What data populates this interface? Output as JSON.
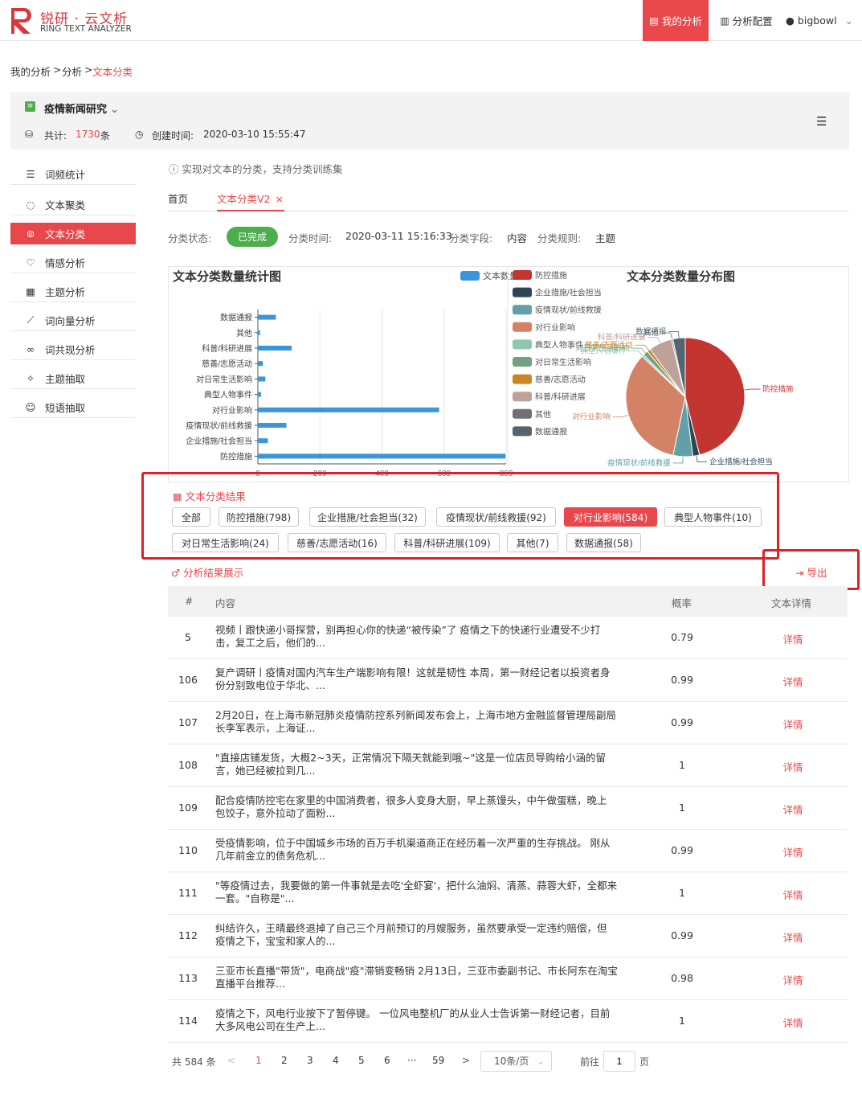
{
  "brand": {
    "title": "锐研 · 云文析",
    "subtitle": "RING TEXT ANALYZER"
  },
  "nav": {
    "my_analysis": "我的分析",
    "config": "分析配置",
    "user": "bigbowl"
  },
  "breadcrumb": {
    "a": "我的分析",
    "sep": ">",
    "b": "分析",
    "c": "文本分类"
  },
  "project": {
    "name": "疫情新闻研究",
    "total_label": "共计:",
    "total": "1730",
    "total_unit": "条",
    "created_label": "创建时间:",
    "created": "2020-03-10 15:55:47"
  },
  "sidebar": [
    {
      "label": "词频统计",
      "icon": "list-icon"
    },
    {
      "label": "文本聚类",
      "icon": "cluster-icon"
    },
    {
      "label": "文本分类",
      "icon": "classify-icon"
    },
    {
      "label": "情感分析",
      "icon": "heartbeat-icon"
    },
    {
      "label": "主题分析",
      "icon": "grid-icon"
    },
    {
      "label": "词向量分析",
      "icon": "vector-icon"
    },
    {
      "label": "词共现分析",
      "icon": "link-icon"
    },
    {
      "label": "主题抽取",
      "icon": "star-icon"
    },
    {
      "label": "短语抽取",
      "icon": "chat-icon"
    }
  ],
  "hint": "实现对文本的分类，支持分类训练集",
  "tabs": {
    "home": "首页",
    "current": "文本分类V2",
    "close": "×"
  },
  "status": {
    "state_label": "分类状态:",
    "state": "已完成",
    "time_label": "分类时间:",
    "time": "2020-03-11 15:16:33",
    "field_label": "分类字段:",
    "field": "内容",
    "rule_label": "分类规则:",
    "rule": "主题"
  },
  "colors": {
    "accent": "#e8484c",
    "bar": "#3a96d8",
    "done": "#4cae4c"
  },
  "chart_data": [
    {
      "type": "bar",
      "title": "文本分类数量统计图",
      "legend": "文本数量",
      "orientation": "horizontal",
      "categories": [
        "数据通报",
        "其他",
        "科普/科研进展",
        "慈善/志愿活动",
        "对日常生活影响",
        "典型人物事件",
        "对行业影响",
        "疫情现状/前线救援",
        "企业措施/社会担当",
        "防控措施"
      ],
      "values": [
        58,
        7,
        109,
        16,
        24,
        10,
        584,
        92,
        32,
        798
      ],
      "xticks": [
        "0",
        "200",
        "400",
        "600",
        "800"
      ],
      "xlim": [
        0,
        800
      ]
    },
    {
      "type": "pie",
      "title": "文本分类数量分布图",
      "labels": [
        "防控措施",
        "企业措施/社会担当",
        "疫情现状/前线救援",
        "对行业影响",
        "典型人物事件",
        "对日常生活影响",
        "慈善/志愿活动",
        "科普/科研进展",
        "其他",
        "数据通报"
      ],
      "values": [
        798,
        32,
        92,
        584,
        10,
        24,
        16,
        109,
        7,
        58
      ],
      "colors": [
        "#c23531",
        "#2f4554",
        "#61a0a8",
        "#d48265",
        "#91c7ae",
        "#749f83",
        "#ca8622",
        "#bda29a",
        "#6e7074",
        "#546570"
      ]
    }
  ],
  "result": {
    "title": "文本分类结果",
    "tags": [
      {
        "label": "全部"
      },
      {
        "label": "防控措施(798)"
      },
      {
        "label": "企业措施/社会担当(32)"
      },
      {
        "label": "疫情现状/前线救援(92)"
      },
      {
        "label": "对行业影响(584)",
        "selected": true
      },
      {
        "label": "典型人物事件(10)"
      },
      {
        "label": "对日常生活影响(24)"
      },
      {
        "label": "慈善/志愿活动(16)"
      },
      {
        "label": "科普/科研进展(109)"
      },
      {
        "label": "其他(7)"
      },
      {
        "label": "数据通报(58)"
      }
    ]
  },
  "analysis": {
    "title": "分析结果展示",
    "export": "导出"
  },
  "table": {
    "headers": {
      "no": "#",
      "content": "内容",
      "prob": "概率",
      "detail": "文本详情"
    },
    "rows": [
      {
        "no": "5",
        "l1": "视频丨跟快递小哥探营，别再担心你的快递“被传染”了 疫情之下的快递行业遭受不少打",
        "l2": "击，复工之后，他们的...",
        "prob": "0.79",
        "detail": "详情"
      },
      {
        "no": "106",
        "l1": "复产调研丨疫情对国内汽车生产端影响有限！这就是韧性 本周，第一财经记者以投资者身",
        "l2": "份分别致电位于华北、...",
        "prob": "0.99",
        "detail": "详情"
      },
      {
        "no": "107",
        "l1": "2月20日，在上海市新冠肺炎疫情防控系列新闻发布会上，上海市地方金融监督管理局副局",
        "l2": "长李军表示，上海证...",
        "prob": "0.99",
        "detail": "详情"
      },
      {
        "no": "108",
        "l1": "\"直接店铺发货，大概2~3天，正常情况下隔天就能到哦~\"这是一位店员导购给小涵的留",
        "l2": "言，她已经被拉到几...",
        "prob": "1",
        "detail": "详情"
      },
      {
        "no": "109",
        "l1": "配合疫情防控宅在家里的中国消费者，很多人变身大厨，早上蒸馒头，中午做蛋糕，晚上",
        "l2": "包饺子，意外拉动了面粉...",
        "prob": "1",
        "detail": "详情"
      },
      {
        "no": "110",
        "l1": "受疫情影响，位于中国城乡市场的百万手机渠道商正在经历着一次严重的生存挑战。 刚从",
        "l2": "几年前金立的债务危机...",
        "prob": "0.99",
        "detail": "详情"
      },
      {
        "no": "111",
        "l1": "\"等疫情过去，我要做的第一件事就是去吃'全虾宴'，把什么油焖、清蒸、蒜蓉大虾，全都来",
        "l2": "一套。\"自称是\"...",
        "prob": "1",
        "detail": "详情"
      },
      {
        "no": "112",
        "l1": "纠结许久，王晴最终退掉了自己三个月前预订的月嫂服务，虽然要承受一定违约赔偿，但",
        "l2": "疫情之下，宝宝和家人的...",
        "prob": "0.99",
        "detail": "详情"
      },
      {
        "no": "113",
        "l1": "三亚市长直播\"带货\"，电商战\"疫\"滞销变畅销 2月13日，三亚市委副书记、市长阿东在淘宝",
        "l2": "直播平台推荐...",
        "prob": "0.98",
        "detail": "详情"
      },
      {
        "no": "114",
        "l1": "疫情之下，风电行业按下了暂停键。 一位风电整机厂的从业人士告诉第一财经记者，目前",
        "l2": "大多风电公司在生产上...",
        "prob": "1",
        "detail": "详情"
      }
    ]
  },
  "pagination": {
    "total_prefix": "共",
    "total": "584",
    "total_suffix": "条",
    "pages": [
      "1",
      "2",
      "3",
      "4",
      "5",
      "6",
      "···",
      "59"
    ],
    "prev": "<",
    "next": ">",
    "page_size": "10条/页",
    "goto_label": "前往",
    "goto_value": "1",
    "goto_suffix": "页"
  }
}
